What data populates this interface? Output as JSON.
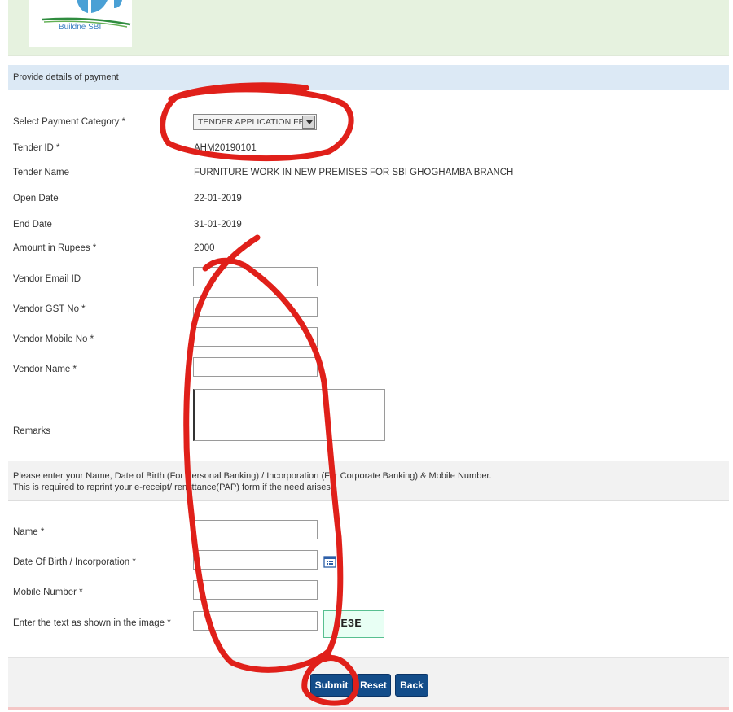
{
  "header": {
    "logo_text": "Buildne SBI"
  },
  "section": {
    "title": "Provide details of payment"
  },
  "form": {
    "payment_category": {
      "label": "Select Payment Category *",
      "value": "TENDER APPLICATION FEE"
    },
    "tender_id": {
      "label": "Tender ID *",
      "value": "AHM20190101"
    },
    "tender_name": {
      "label": "Tender Name",
      "value": "FURNITURE WORK IN NEW PREMISES FOR SBI GHOGHAMBA BRANCH"
    },
    "open_date": {
      "label": "Open Date",
      "value": "22-01-2019"
    },
    "end_date": {
      "label": "End Date",
      "value": "31-01-2019"
    },
    "amount": {
      "label": "Amount in Rupees *",
      "value": "2000"
    },
    "vendor_email": {
      "label": "Vendor Email ID",
      "value": ""
    },
    "vendor_gst": {
      "label": "Vendor GST No *",
      "value": ""
    },
    "vendor_mobile": {
      "label": "Vendor Mobile No *",
      "value": ""
    },
    "vendor_name": {
      "label": "Vendor Name *",
      "value": ""
    },
    "remarks": {
      "label": "Remarks",
      "value": ""
    }
  },
  "info": {
    "line1": "Please enter your Name, Date of Birth (For Personal Banking) / Incorporation (For Corporate Banking) & Mobile Number.",
    "line2": "This is required to reprint your e-receipt/ remittance(PAP) form if the need arises."
  },
  "reprint": {
    "name": {
      "label": "Name *",
      "value": ""
    },
    "dob": {
      "label": "Date Of Birth / Incorporation *",
      "value": ""
    },
    "mobile": {
      "label": "Mobile Number *",
      "value": ""
    },
    "captcha": {
      "label": "Enter the text as shown in the image *",
      "value": "",
      "image_text": "1E3E"
    }
  },
  "buttons": {
    "submit": "Submit",
    "reset": "Reset",
    "back": "Back"
  },
  "colors": {
    "banner_bg": "#e6f2df",
    "section_bg": "#dce9f5",
    "button_bg": "#134d8a",
    "annotation_red": "#e0201a"
  }
}
